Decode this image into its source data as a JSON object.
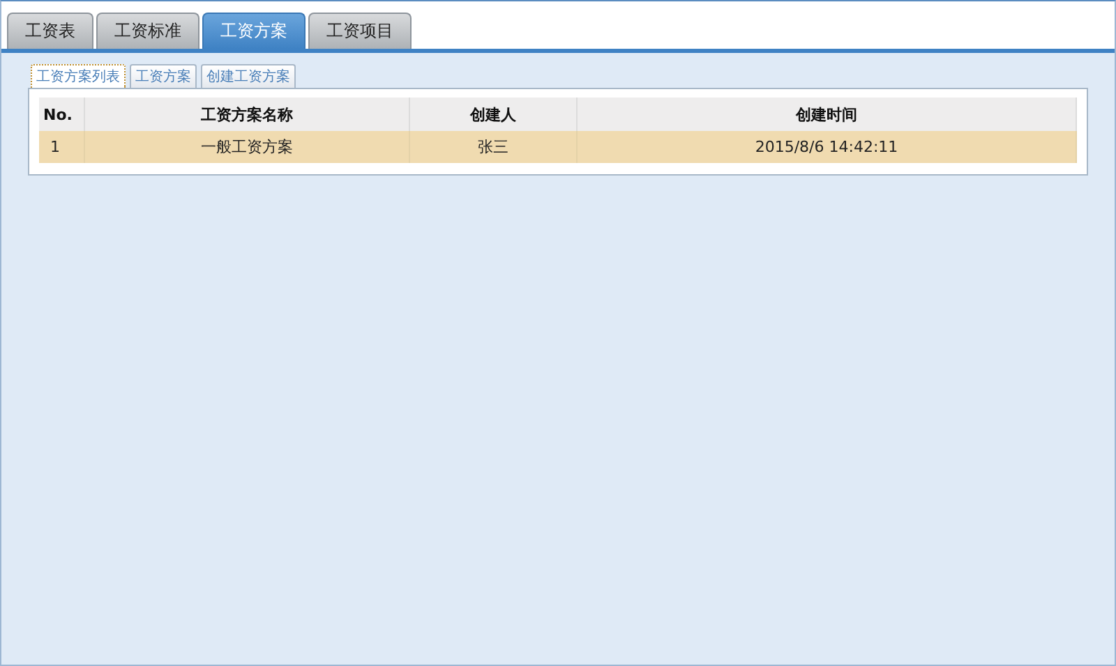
{
  "tabs": [
    {
      "label": "工资表",
      "selected": false
    },
    {
      "label": "工资标准",
      "selected": false
    },
    {
      "label": "工资方案",
      "selected": true
    },
    {
      "label": "工资项目",
      "selected": false
    }
  ],
  "subtabs": [
    {
      "label": "工资方案列表",
      "selected": true
    },
    {
      "label": "工资方案",
      "selected": false
    },
    {
      "label": "创建工资方案",
      "selected": false
    }
  ],
  "table": {
    "columns": [
      "No.",
      "工资方案名称",
      "创建人",
      "创建时间"
    ],
    "rows": [
      {
        "cells": [
          "1",
          "一般工资方案",
          "张三",
          "2015/8/6 14:42:11"
        ],
        "selected": true
      }
    ]
  }
}
